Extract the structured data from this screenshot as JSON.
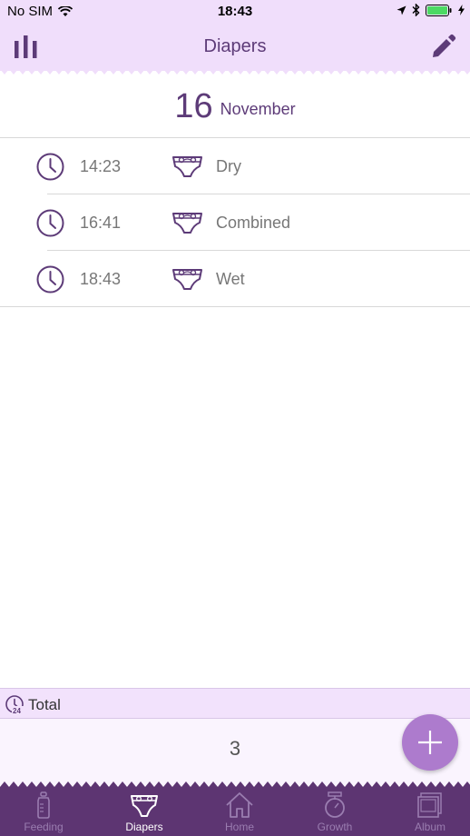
{
  "status_bar": {
    "carrier": "No SIM",
    "time": "18:43"
  },
  "navbar": {
    "title": "Diapers",
    "left_icon": "stats-bars-icon",
    "right_icon": "pencil-edit-icon"
  },
  "date_header": {
    "day": "16",
    "month": "November"
  },
  "entries": [
    {
      "time": "14:23",
      "type": "Dry"
    },
    {
      "time": "16:41",
      "type": "Combined"
    },
    {
      "time": "18:43",
      "type": "Wet"
    }
  ],
  "total": {
    "label": "Total",
    "value": "3"
  },
  "tabs": [
    {
      "label": "Feeding",
      "icon": "bottle-icon",
      "active": false
    },
    {
      "label": "Diapers",
      "icon": "diaper-icon",
      "active": true
    },
    {
      "label": "Home",
      "icon": "home-icon",
      "active": false
    },
    {
      "label": "Growth",
      "icon": "scale-icon",
      "active": false
    },
    {
      "label": "Album",
      "icon": "photo-album-icon",
      "active": false
    }
  ],
  "colors": {
    "accent": "#5d3b78",
    "header_bg": "#f0defb",
    "tabbar_bg": "#5d3572",
    "fab": "#ad7bcd"
  }
}
